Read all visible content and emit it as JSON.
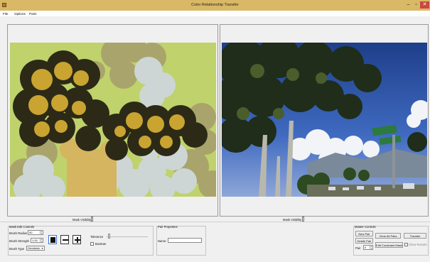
{
  "window": {
    "title": "Color Relationship Transfer"
  },
  "menu": {
    "items": [
      "File",
      "Options",
      "Pairs"
    ]
  },
  "left_panel": {
    "mask_visibility_label": "Mask Visibility"
  },
  "right_panel": {
    "mask_visibility_label": "Mask Visibility"
  },
  "mask_edit": {
    "title": "Mask Edit Controls",
    "brush_radius_label": "Brush Radius",
    "brush_radius_value": "50",
    "brush_strength_label": "Brush Strength",
    "brush_strength_value": "1.00",
    "brush_type_label": "Brush Type",
    "brush_type_value": "Geodesic",
    "tolerance_label": "Tolerance",
    "boolean_label": "Boolean"
  },
  "pair_properties": {
    "title": "Pair Properties",
    "name_label": "Name:",
    "name_value": ""
  },
  "master_controls": {
    "title": "Master Controls",
    "new_pair": "New Pair",
    "delete_pair": "Delete Pair",
    "clear_all_pairs": "Clear All Pairs",
    "transfer": "Transfer",
    "pair_label": "Pair",
    "pair_value": "0",
    "edit_constraint_mask": "Edit Constraint Mask",
    "show_results": "Show Results"
  },
  "colors": {
    "title_bar": "#d9b866",
    "mask_bg": "#bfd26c",
    "selection": "#3a78d6"
  }
}
